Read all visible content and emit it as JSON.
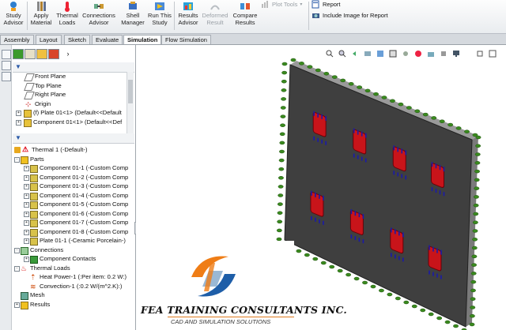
{
  "ribbon": {
    "buttons": [
      {
        "id": "study_advisor",
        "label": "Study Advisor",
        "icon": "study-advisor-icon"
      },
      {
        "id": "apply_material",
        "label": "Apply Material",
        "icon": "material-icon"
      },
      {
        "id": "thermal_loads",
        "label": "Thermal Loads",
        "icon": "thermal-loads-icon"
      },
      {
        "id": "connections_advisor",
        "label": "Connections Advisor",
        "icon": "connections-icon"
      },
      {
        "id": "shell_manager",
        "label": "Shell Manager",
        "icon": "shell-icon"
      },
      {
        "id": "run_this_study",
        "label": "Run This Study",
        "icon": "run-icon"
      },
      {
        "id": "results_advisor",
        "label": "Results Advisor",
        "icon": "results-icon"
      },
      {
        "id": "deformed_result",
        "label": "Deformed Result",
        "icon": "deformed-icon",
        "disabled": true
      },
      {
        "id": "compare_results",
        "label": "Compare Results",
        "icon": "compare-icon"
      }
    ],
    "plot_tools": "Plot Tools",
    "report": "Report",
    "include_image": "Include Image for Report"
  },
  "tabs": [
    {
      "label": "Assembly"
    },
    {
      "label": "Layout"
    },
    {
      "label": "Sketch"
    },
    {
      "label": "Evaluate"
    },
    {
      "label": "Simulation",
      "active": true
    },
    {
      "label": "Flow Simulation"
    }
  ],
  "feature_tree": {
    "items": [
      {
        "label": "Front Plane",
        "icon": "plane-icon"
      },
      {
        "label": "Top Plane",
        "icon": "plane-icon"
      },
      {
        "label": "Right Plane",
        "icon": "plane-icon"
      },
      {
        "label": "Origin",
        "icon": "origin-icon"
      },
      {
        "label": "(f) Plate 01<1> (Default<<Default",
        "icon": "part-icon"
      },
      {
        "label": "Component 01<1> (Default<<Def",
        "icon": "part-icon"
      }
    ]
  },
  "study_tree": {
    "root": "Thermal 1 (-Default-)",
    "parts_label": "Parts",
    "components": [
      "Component 01-1 (-Custom Comp",
      "Component 01-2 (-Custom Comp",
      "Component 01-3 (-Custom Comp",
      "Component 01-4 (-Custom Comp",
      "Component 01-5 (-Custom Comp",
      "Component 01-6 (-Custom Comp",
      "Component 01-7 (-Custom Comp",
      "Component 01-8 (-Custom Comp",
      "Plate 01-1 (-Ceramic Porcelain-)"
    ],
    "connections_label": "Connections",
    "component_contacts": "Component Contacts",
    "thermal_loads_label": "Thermal Loads",
    "heat_power": "Heat Power-1 (:Per item: 0.2 W:)",
    "convection": "Convection-1 (:0.2 W/(m^2.K):)",
    "mesh": "Mesh",
    "results": "Results"
  },
  "logo": {
    "company": "FEA TRAINING  CONSULTANTS INC.",
    "tagline": "CAD AND SIMULATION SOLUTIONS"
  },
  "colors": {
    "plate": "#3f3f3f",
    "component": "#c8141a",
    "heat_arrow": "#1a1aa8",
    "convection": "#3a8a1e"
  }
}
